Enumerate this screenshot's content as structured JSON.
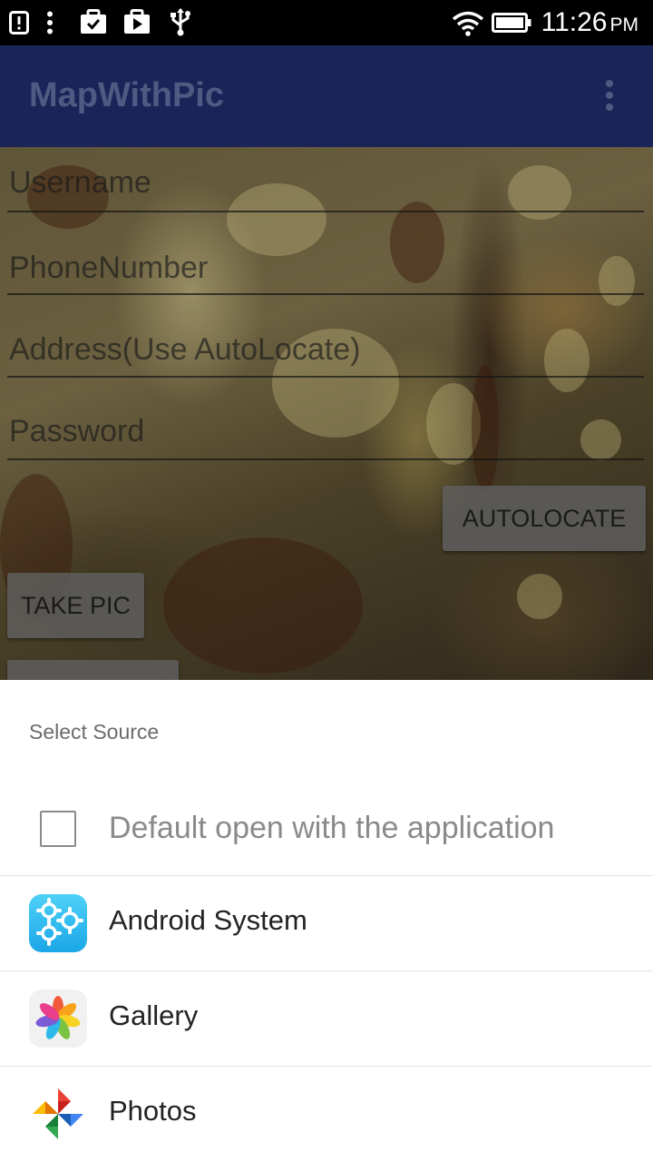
{
  "status_bar": {
    "time": "11:26",
    "ampm": "PM",
    "icons": [
      "alert-icon",
      "more-vert-icon",
      "briefcase-check-icon",
      "play-store-icon",
      "usb-icon",
      "wifi-icon",
      "battery-icon"
    ]
  },
  "app_bar": {
    "title": "MapWithPic",
    "overflow_icon": "overflow-menu-icon"
  },
  "form": {
    "username_hint": "Username",
    "phone_hint": "PhoneNumber",
    "address_hint": "Address(Use AutoLocate)",
    "password_hint": "Password",
    "autolocate_label": "AUTOLOCATE",
    "take_pic_label": "TAKE PIC"
  },
  "sheet": {
    "title": "Select Source",
    "default_label": "Default open with the application",
    "apps": [
      {
        "label": "Android System",
        "icon": "android-system-gears-icon"
      },
      {
        "label": "Gallery",
        "icon": "gallery-flower-icon"
      },
      {
        "label": "Photos",
        "icon": "google-photos-pinwheel-icon"
      }
    ]
  },
  "colors": {
    "app_bar": "#1a2458",
    "sheet_bg": "#ffffff",
    "android_system_icon": "#29b6f6"
  }
}
